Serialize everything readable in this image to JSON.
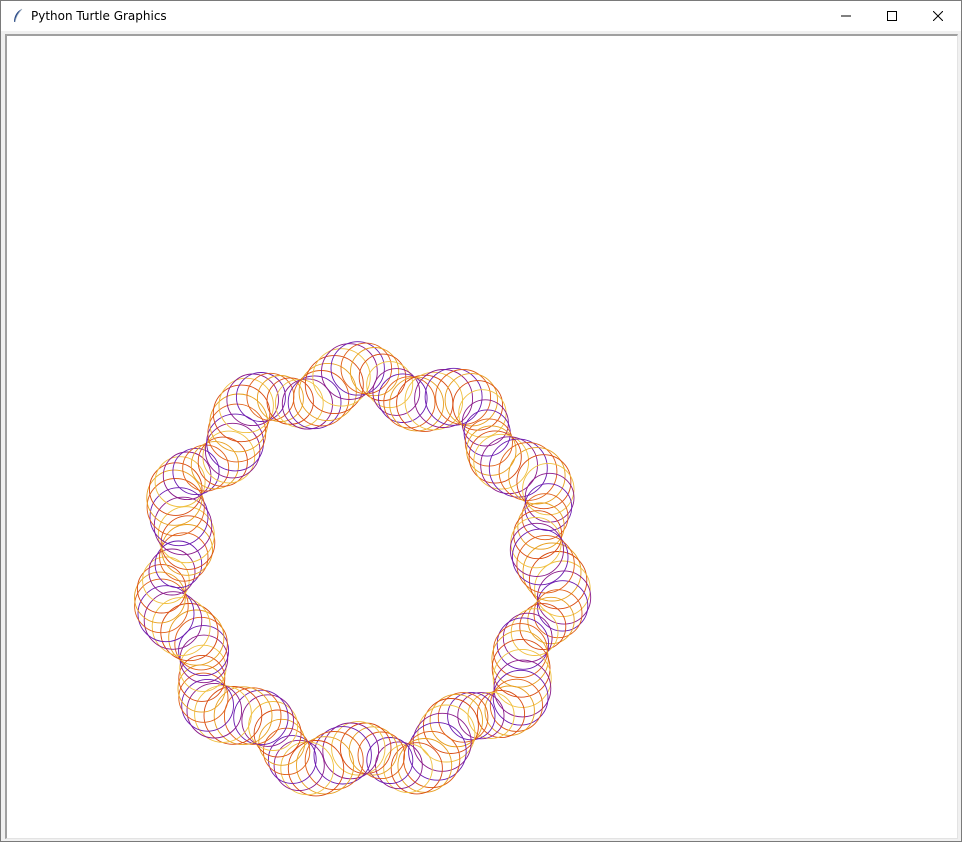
{
  "window": {
    "title": "Python Turtle Graphics",
    "icon": "feather-icon"
  },
  "controls": {
    "minimize_icon": "minimize-icon",
    "maximize_icon": "maximize-icon",
    "close_icon": "close-icon"
  },
  "drawing": {
    "shape": "ring of overlapping circles",
    "colors": [
      "#e8a020",
      "#d84a10",
      "#f0c040",
      "#8a1a8a",
      "#6a1ab0",
      "#e06018"
    ]
  }
}
